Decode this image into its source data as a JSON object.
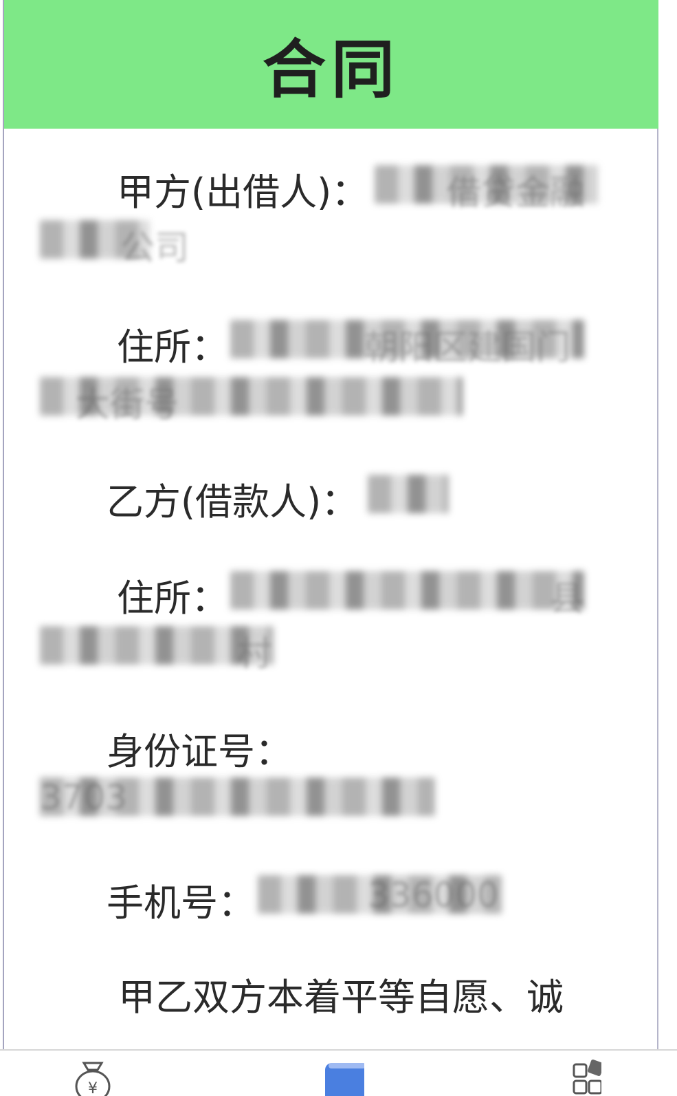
{
  "header": {
    "title": "合同"
  },
  "party_a": {
    "label": "甲方(出借人)：",
    "value_visible": "借贷金融",
    "value_line2_visible": "公司"
  },
  "address_a": {
    "label": "住所：",
    "value_visible": "朝阳区建国门",
    "value_line2_visible": "大街号"
  },
  "party_b": {
    "label": "乙方(借款人)："
  },
  "address_b": {
    "label": "住所：",
    "value_visible": "县",
    "value_line2_visible": "村"
  },
  "id_number": {
    "label": "身份证号：",
    "value_visible": "3703"
  },
  "phone": {
    "label": "手机号：",
    "value_visible": "336000"
  },
  "paragraph": {
    "text": "甲乙双方本着平等自愿、诚"
  },
  "colors": {
    "header_bg": "#7ee887",
    "tab_active": "#4a7fe0"
  },
  "bottom_nav": {
    "icons": [
      "money-bag-icon",
      "document-icon",
      "apps-grid-icon"
    ]
  }
}
